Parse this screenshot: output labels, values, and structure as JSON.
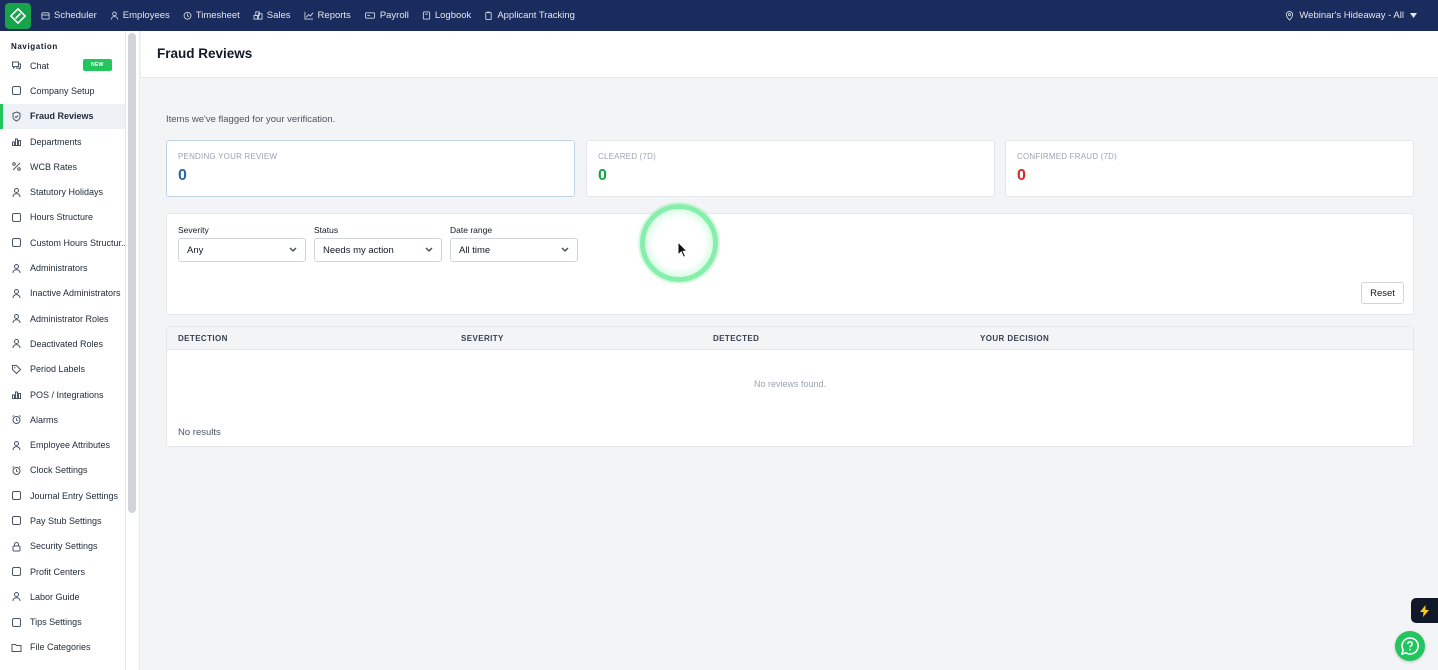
{
  "topbar": {
    "nav": [
      {
        "label": "Scheduler",
        "icon": "calendar-icon"
      },
      {
        "label": "Employees",
        "icon": "user-icon"
      },
      {
        "label": "Timesheet",
        "icon": "clock-icon"
      },
      {
        "label": "Sales",
        "icon": "coins-icon"
      },
      {
        "label": "Reports",
        "icon": "chart-line-icon"
      },
      {
        "label": "Payroll",
        "icon": "money-icon"
      },
      {
        "label": "Logbook",
        "icon": "book-icon"
      },
      {
        "label": "Applicant Tracking",
        "icon": "clipboard-icon"
      }
    ],
    "location": "Webinar's Hideaway - All"
  },
  "sidebar": {
    "heading": "Navigation",
    "items": [
      {
        "label": "Chat",
        "icon": "chat-icon",
        "badge": "NEW"
      },
      {
        "label": "Company Setup",
        "icon": "building-icon"
      },
      {
        "label": "Fraud Reviews",
        "icon": "shield-icon",
        "active": true
      },
      {
        "label": "Departments",
        "icon": "departments-icon"
      },
      {
        "label": "WCB Rates",
        "icon": "percent-icon"
      },
      {
        "label": "Statutory Holidays",
        "icon": "holiday-icon"
      },
      {
        "label": "Hours Structure",
        "icon": "hours-icon"
      },
      {
        "label": "Custom Hours Structur...",
        "icon": "hours-custom-icon"
      },
      {
        "label": "Administrators",
        "icon": "admin-icon"
      },
      {
        "label": "Inactive Administrators",
        "icon": "admin-inactive-icon"
      },
      {
        "label": "Administrator Roles",
        "icon": "admin-roles-icon"
      },
      {
        "label": "Deactivated Roles",
        "icon": "roles-deactivated-icon"
      },
      {
        "label": "Period Labels",
        "icon": "tag-icon"
      },
      {
        "label": "POS / Integrations",
        "icon": "pos-icon"
      },
      {
        "label": "Alarms",
        "icon": "alarm-icon"
      },
      {
        "label": "Employee Attributes",
        "icon": "attributes-icon"
      },
      {
        "label": "Clock Settings",
        "icon": "clock-settings-icon"
      },
      {
        "label": "Journal Entry Settings",
        "icon": "journal-icon"
      },
      {
        "label": "Pay Stub Settings",
        "icon": "paystub-icon"
      },
      {
        "label": "Security Settings",
        "icon": "lock-icon"
      },
      {
        "label": "Profit Centers",
        "icon": "profit-icon"
      },
      {
        "label": "Labor Guide",
        "icon": "labor-icon"
      },
      {
        "label": "Tips Settings",
        "icon": "tips-icon"
      },
      {
        "label": "File Categories",
        "icon": "folder-icon"
      }
    ]
  },
  "page": {
    "title": "Fraud Reviews",
    "intro": "Items we've flagged for your verification."
  },
  "stats": [
    {
      "label": "PENDING YOUR REVIEW",
      "value": "0",
      "color": "#2b6a9e"
    },
    {
      "label": "CLEARED (7D)",
      "value": "0",
      "color": "#16a34a"
    },
    {
      "label": "CONFIRMED FRAUD (7D)",
      "value": "0",
      "color": "#dc2626"
    }
  ],
  "filters": {
    "severity": {
      "label": "Severity",
      "value": "Any"
    },
    "status": {
      "label": "Status",
      "value": "Needs my action"
    },
    "date_range": {
      "label": "Date range",
      "value": "All time"
    },
    "reset_label": "Reset"
  },
  "table": {
    "columns": [
      "DETECTION",
      "SEVERITY",
      "DETECTED",
      "YOUR DECISION"
    ],
    "empty_text": "No reviews found.",
    "footer_text": "No results"
  },
  "colors": {
    "topbar_bg": "#1a2b5e",
    "accent": "#22c55e"
  }
}
